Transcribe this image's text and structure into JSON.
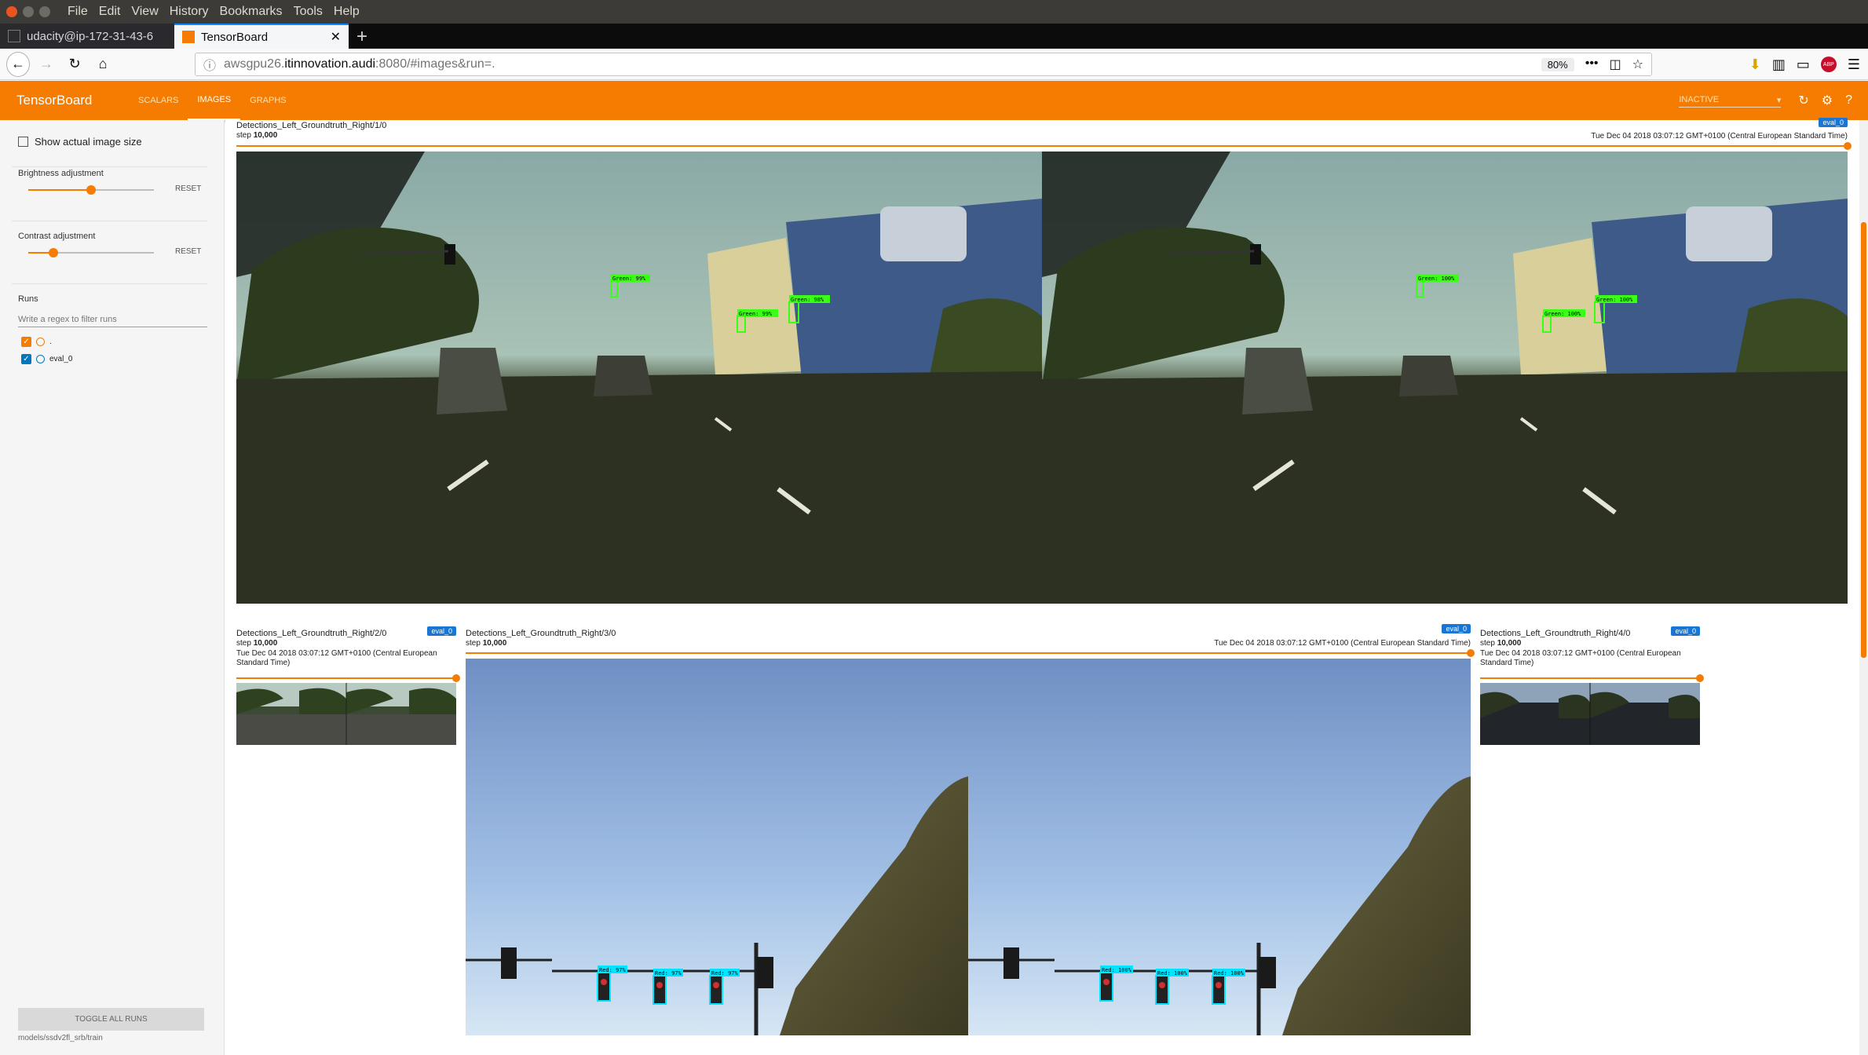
{
  "os": {
    "menu": [
      "File",
      "Edit",
      "View",
      "History",
      "Bookmarks",
      "Tools",
      "Help"
    ],
    "window_colors": [
      "#e95420",
      "#6d6b66",
      "#6d6b66"
    ]
  },
  "browser": {
    "tabs": [
      {
        "title": "udacity@ip-172-31-43-6",
        "active": false
      },
      {
        "title": "TensorBoard",
        "active": true
      }
    ],
    "new_tab": "+",
    "url_prefix": "awsgpu26.",
    "url_host": "itinnovation.audi",
    "url_suffix": ":8080/#images&run=.",
    "zoom": "80%",
    "icons": {
      "back": "back-icon",
      "forward": "forward-icon",
      "reload": "reload-icon",
      "home": "home-icon",
      "info": "info-icon",
      "more": "more-icon",
      "pocket": "pocket-icon",
      "bookmark": "star-icon",
      "download": "download-icon",
      "library": "library-icon",
      "sidebar": "sidebar-icon",
      "abp": "adblock-icon",
      "menu": "hamburger-icon"
    },
    "abp_label": "ABP"
  },
  "tensorboard": {
    "title": "TensorBoard",
    "tabs": [
      "SCALARS",
      "IMAGES",
      "GRAPHS"
    ],
    "active_tab": "IMAGES",
    "run_select": "INACTIVE",
    "accent": "#f57c00"
  },
  "sidebar": {
    "show_actual_size": "Show actual image size",
    "brightness": {
      "label": "Brightness adjustment",
      "reset": "RESET",
      "value_fraction": 0.5
    },
    "contrast": {
      "label": "Contrast adjustment",
      "reset": "RESET",
      "value_fraction": 0.2
    },
    "runs_label": "Runs",
    "filter_placeholder": "Write a regex to filter runs",
    "runs": [
      {
        "name": ".",
        "color": "#f57c00",
        "checked": true
      },
      {
        "name": "eval_0",
        "color": "#0277bd",
        "checked": true
      }
    ],
    "toggle_all": "TOGGLE ALL RUNS",
    "footer": "models/ssdv2fl_srb/train"
  },
  "cards": [
    {
      "title": "Detections_Left_Groundtruth_Right/1/0",
      "step_label": "step",
      "step": "10,000",
      "date": "Tue Dec 04 2018 03:07:12 GMT+0100 (Central European Standard Time)",
      "badge": "eval_0",
      "detections": [
        "Green: 99%",
        "Green: 99%",
        "Green: 98%",
        "Green: 100%",
        "Green: 100%",
        "Green: 100%"
      ]
    },
    {
      "title": "Detections_Left_Groundtruth_Right/2/0",
      "step_label": "step",
      "step": "10,000",
      "date_line1": "Tue Dec 04 2018 03:07:12 GMT+0100 (Central European",
      "date_line2": "Standard Time)",
      "badge": "eval_0"
    },
    {
      "title": "Detections_Left_Groundtruth_Right/3/0",
      "step_label": "step",
      "step": "10,000",
      "date": "Tue Dec 04 2018 03:07:12 GMT+0100 (Central European Standard Time)",
      "badge": "eval_0",
      "detections": [
        "Red: 97%",
        "Red: 97%",
        "Red: 97%",
        "Red: 100%",
        "Red: 100%",
        "Red: 100%"
      ]
    },
    {
      "title": "Detections_Left_Groundtruth_Right/4/0",
      "step_label": "step",
      "step": "10,000",
      "date_line1": "Tue Dec 04 2018 03:07:12 GMT+0100 (Central European",
      "date_line2": "Standard Time)",
      "badge": "eval_0"
    }
  ]
}
